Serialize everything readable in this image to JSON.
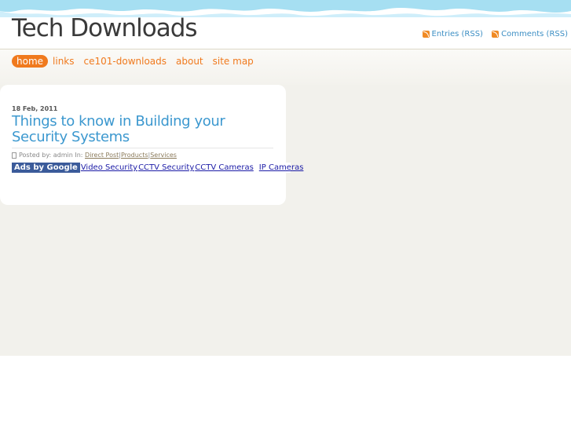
{
  "header": {
    "site_title": "Tech Downloads",
    "rss": [
      {
        "label": "Entries (RSS)",
        "icon": "rss-icon"
      },
      {
        "label": "Comments (RSS)",
        "icon": "rss-icon"
      }
    ]
  },
  "nav": {
    "items": [
      "home",
      "links",
      "ce101-downloads",
      "about",
      "site map"
    ],
    "active": "home"
  },
  "post": {
    "date": "18 Feb, 2011",
    "title": "Things to know in Building your Security Systems",
    "meta_prefix": "Posted by: admin In:",
    "categories": [
      "Direct Post",
      "Products",
      "Services"
    ]
  },
  "ads": {
    "label": "Ads by Google",
    "links": [
      "Video Security",
      "CCTV Security",
      "CCTV Cameras",
      "IP Cameras"
    ]
  },
  "colors": {
    "accent_orange": "#f07a1e",
    "link_blue": "#3c98cf",
    "wave_blue": "#a6dff2"
  }
}
